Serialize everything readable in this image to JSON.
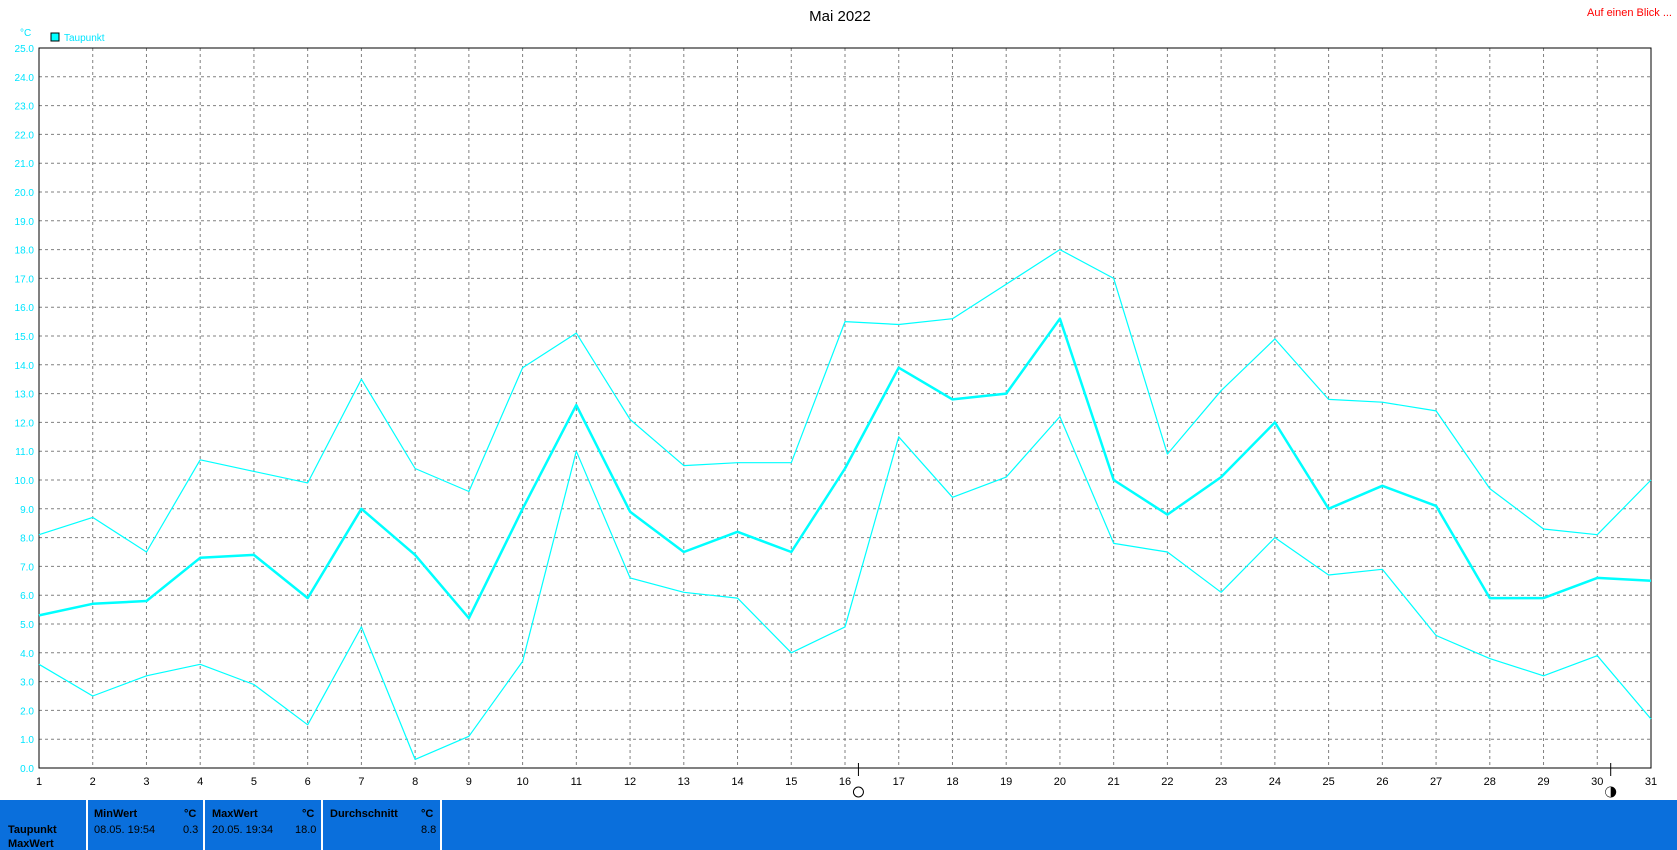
{
  "header": {
    "title": "Mai 2022",
    "link": "Auf einen Blick ..."
  },
  "chart_data": {
    "type": "line",
    "title": "Mai 2022",
    "ylabel": "°C",
    "xlabel": "",
    "ylim": [
      0,
      25
    ],
    "xlim": [
      1,
      31
    ],
    "grid": true,
    "legend": {
      "position": "top-left",
      "entries": [
        "Taupunkt"
      ]
    },
    "y_ticks": [
      "0.0",
      "1.0",
      "2.0",
      "3.0",
      "4.0",
      "5.0",
      "6.0",
      "7.0",
      "8.0",
      "9.0",
      "10.0",
      "11.0",
      "12.0",
      "13.0",
      "14.0",
      "15.0",
      "16.0",
      "17.0",
      "18.0",
      "19.0",
      "20.0",
      "21.0",
      "22.0",
      "23.0",
      "24.0",
      "25.0"
    ],
    "x": [
      1,
      2,
      3,
      4,
      5,
      6,
      7,
      8,
      9,
      10,
      11,
      12,
      13,
      14,
      15,
      16,
      17,
      18,
      19,
      20,
      21,
      22,
      23,
      24,
      25,
      26,
      27,
      28,
      29,
      30,
      31
    ],
    "series": [
      {
        "name": "Taupunkt",
        "role": "mean",
        "values": [
          5.3,
          5.7,
          5.8,
          7.3,
          7.4,
          5.9,
          9.0,
          7.4,
          5.2,
          9.0,
          12.6,
          8.9,
          7.5,
          8.2,
          7.5,
          10.4,
          13.9,
          12.8,
          13.0,
          15.6,
          10.0,
          8.8,
          10.1,
          12.0,
          9.0,
          9.8,
          9.1,
          5.9,
          5.9,
          6.6,
          6.5
        ]
      },
      {
        "role": "max",
        "values": [
          8.1,
          8.7,
          7.5,
          10.7,
          10.3,
          9.9,
          13.5,
          10.4,
          9.6,
          13.9,
          15.1,
          12.1,
          10.5,
          10.6,
          10.6,
          15.5,
          15.4,
          15.6,
          16.8,
          18.0,
          17.0,
          10.9,
          13.1,
          14.9,
          12.8,
          12.7,
          12.4,
          9.7,
          8.3,
          8.1,
          10.0
        ]
      },
      {
        "role": "min",
        "values": [
          3.6,
          2.5,
          3.2,
          3.6,
          2.9,
          1.5,
          4.9,
          0.3,
          1.1,
          3.7,
          11.0,
          6.6,
          6.1,
          5.9,
          4.0,
          4.9,
          11.5,
          9.4,
          10.1,
          12.2,
          7.8,
          7.5,
          6.1,
          8.0,
          6.7,
          6.9,
          4.6,
          3.8,
          3.2,
          3.9,
          1.7
        ]
      }
    ],
    "colors": {
      "series": "#00ffff",
      "grid": "#808080",
      "axis": "#000000",
      "link": "#ff0000"
    },
    "moon_phases": [
      {
        "day": 16,
        "icon": "full-moon-icon"
      },
      {
        "day": 30,
        "icon": "new-moon-icon"
      }
    ]
  },
  "info_panel": {
    "row_labels": [
      "Taupunkt",
      "MaxWert"
    ],
    "columns": [
      {
        "header": "MinWert",
        "unit": "°C",
        "datetime": "08.05.  19:54",
        "value": "0.3"
      },
      {
        "header": "MaxWert",
        "unit": "°C",
        "datetime": "20.05.  19:34",
        "value": "18.0"
      },
      {
        "header": "Durchschnitt",
        "unit": "°C",
        "datetime": "",
        "value": "8.8"
      }
    ]
  }
}
